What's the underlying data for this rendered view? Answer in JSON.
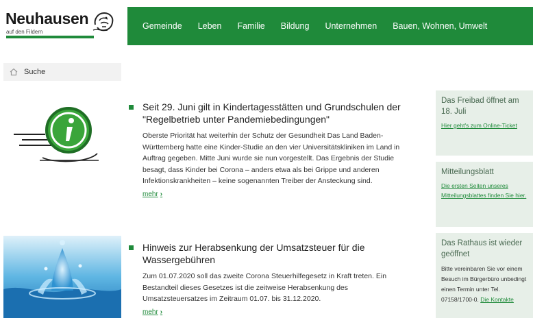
{
  "header": {
    "logo_title": "Neuhausen",
    "logo_subtitle": "auf den Fildern",
    "nav": [
      "Gemeinde",
      "Leben",
      "Familie",
      "Bildung",
      "Unternehmen",
      "Bauen, Wohnen, Umwelt"
    ]
  },
  "search": {
    "label": "Suche"
  },
  "articles": [
    {
      "title": "Seit 29. Juni gilt in Kindertagesstätten und Grundschulen der \"Regelbetrieb unter Pandemiebedingungen\"",
      "body": "Oberste Priorität hat weiterhin der Schutz der Gesundheit Das Land Baden-Württemberg hatte eine Kinder-Studie an den vier Universitätskliniken im Land in Auftrag gegeben. Mitte Juni wurde sie nun vorgestellt. Das Ergebnis der Studie besagt, dass Kinder bei Corona – anders etwa als bei Grippe und anderen Infektionskrankheiten – keine sogenannten Treiber der Ansteckung sind.",
      "more": "mehr"
    },
    {
      "title": "Hinweis zur Herabsenkung der Umsatzsteuer für die Wassergebühren",
      "body": "Zum 01.07.2020 soll das zweite Corona Steuerhilfegesetz in Kraft treten. Ein Bestandteil dieses Gesetzes ist die zeitweise Herabsenkung des Umsatzsteuersatzes im Zeitraum 01.07. bis 31.12.2020.",
      "more": "mehr"
    }
  ],
  "sidebar": [
    {
      "title": "Das Freibad öffnet am 18. Juli",
      "link": "Hier geht's zum Online-Ticket"
    },
    {
      "title": "Mitteilungsblatt",
      "link": "Die ersten Seiten unseres Mitteilungsblattes finden Sie hier."
    },
    {
      "title": "Das Rathaus ist wieder geöffnet",
      "text": "Bitte vereinbaren Sie vor einem Besuch im Bürgerbüro unbedingt einen Termin unter Tel. 07158/1700-0.",
      "link": "Die Kontakte"
    }
  ],
  "colors": {
    "brand_green": "#1f8a3a",
    "sidebar_bg": "#e7efe8"
  }
}
